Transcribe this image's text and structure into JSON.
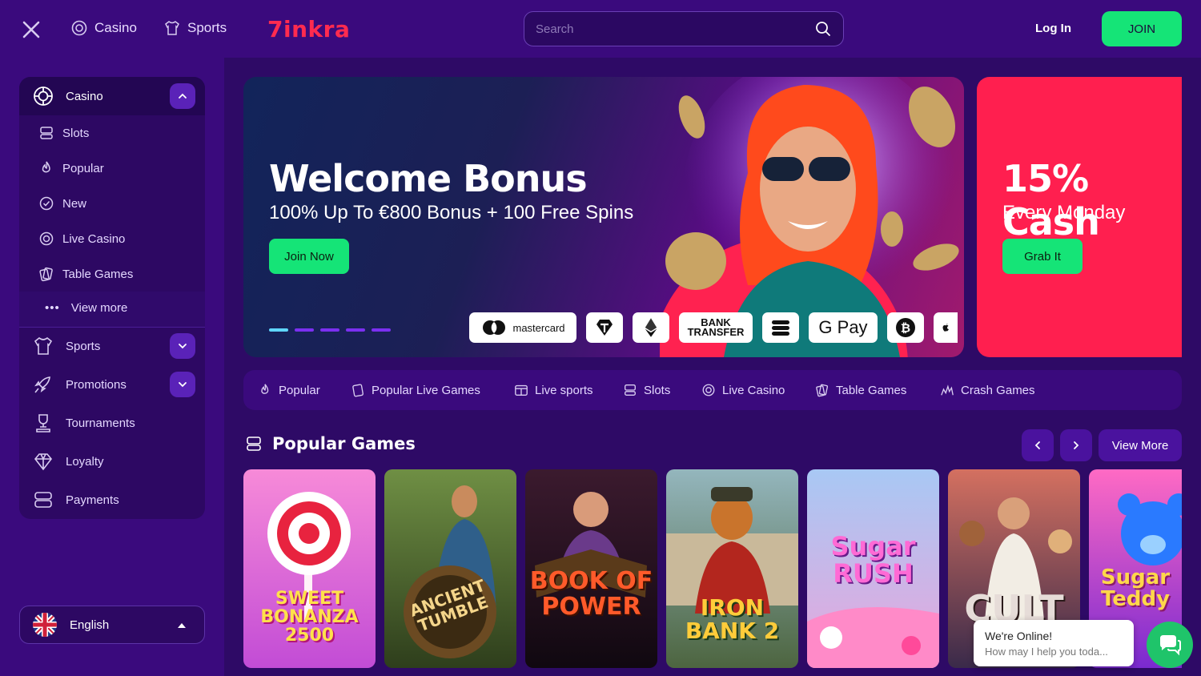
{
  "header": {
    "casino_label": "Casino",
    "sports_label": "Sports",
    "logo_text": "7inkra",
    "search_placeholder": "Search",
    "login_label": "Log In",
    "join_label": "JOIN"
  },
  "sidebar": {
    "casino_label": "Casino",
    "sub_items": [
      {
        "label": "Slots",
        "icon": "slot-machine-icon"
      },
      {
        "label": "Popular",
        "icon": "flame-icon"
      },
      {
        "label": "New",
        "icon": "badge-check-icon"
      },
      {
        "label": "Live Casino",
        "icon": "poker-chip-icon"
      },
      {
        "label": "Table Games",
        "icon": "cards-icon"
      }
    ],
    "view_more_label": "View more",
    "main_items": [
      {
        "label": "Sports",
        "icon": "jersey-icon"
      },
      {
        "label": "Promotions",
        "icon": "rocket-icon"
      },
      {
        "label": "Tournaments",
        "icon": "trophy-icon"
      },
      {
        "label": "Loyalty",
        "icon": "diamond-icon"
      },
      {
        "label": "Payments",
        "icon": "wallet-icon"
      }
    ],
    "language": "English"
  },
  "banner": {
    "title": "Welcome Bonus",
    "subtitle": "100% Up To €800 Bonus + 100 Free Spins",
    "cta": "Join Now",
    "payments": [
      "mastercard",
      "BANK TRANSFER",
      "G Pay"
    ]
  },
  "banner2": {
    "title": "15% Cash",
    "subtitle": "Every Monday",
    "cta": "Grab It"
  },
  "categories": [
    {
      "label": "Popular",
      "icon": "flame-icon"
    },
    {
      "label": "Popular Live Games",
      "icon": "cards-icon"
    },
    {
      "label": "Live sports",
      "icon": "scoreboard-icon"
    },
    {
      "label": "Slots",
      "icon": "slot-machine-icon"
    },
    {
      "label": "Live Casino",
      "icon": "poker-chip-icon"
    },
    {
      "label": "Table Games",
      "icon": "cards-icon"
    },
    {
      "label": "Crash Games",
      "icon": "crash-icon"
    }
  ],
  "popular": {
    "title": "Popular Games",
    "view_more": "View More",
    "games": [
      {
        "name": "SWEET BONANZA 2500",
        "colors": [
          "#f46fd0",
          "#a03cd6"
        ]
      },
      {
        "name": "ANCIENT TUMBLE",
        "colors": [
          "#5c7a3a",
          "#2c3a1a"
        ]
      },
      {
        "name": "BOOK OF POWER",
        "colors": [
          "#3a1a2a",
          "#120a10"
        ]
      },
      {
        "name": "IRON BANK 2",
        "colors": [
          "#7fa0a8",
          "#4a5d40"
        ]
      },
      {
        "name": "Sugar RUSH",
        "colors": [
          "#a9c4f0",
          "#e0a0dc"
        ]
      },
      {
        "name": "CULT",
        "colors": [
          "#c06050",
          "#3a2a4a"
        ]
      },
      {
        "name": "Sugar Teddy",
        "colors": [
          "#ff5fc0",
          "#7a2ad0"
        ]
      }
    ]
  },
  "chat": {
    "title": "We're Online!",
    "subtitle": "How may I help you toda..."
  }
}
